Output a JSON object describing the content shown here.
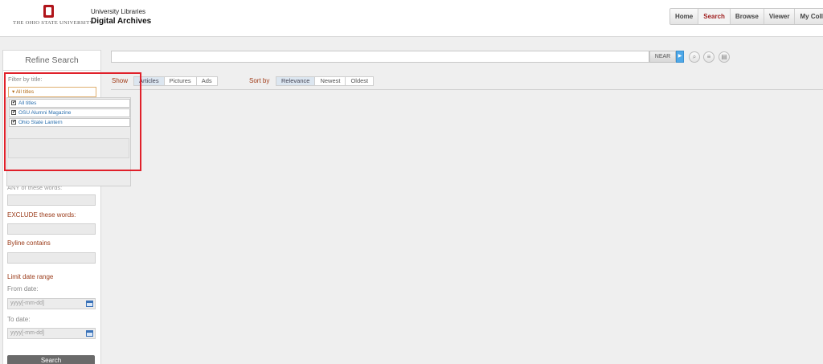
{
  "header": {
    "logo_text": "THE OHIO STATE UNIVERSITY",
    "brand_line1": "University Libraries",
    "brand_line2": "Digital Archives",
    "nav": [
      {
        "label": "Home"
      },
      {
        "label": "Search"
      },
      {
        "label": "Browse"
      },
      {
        "label": "Viewer"
      },
      {
        "label": "My Collecti"
      }
    ],
    "active_nav": "Search"
  },
  "sidebar": {
    "title": "Refine Search",
    "filter_label": "Filter by title:",
    "dropdown_value": "▾ All titles",
    "dropdown_items": [
      {
        "label": "All titles",
        "checked": true
      },
      {
        "label": "OSU Alumni Magazine",
        "checked": true
      },
      {
        "label": "Ohio State Lantern",
        "checked": true
      }
    ],
    "partial_label": "ANY of these words:",
    "exclude_label": "EXCLUDE these words:",
    "byline_label": "Byline contains",
    "date_range_label": "Limit date range",
    "from_label": "From date:",
    "to_label": "To date:",
    "date_placeholder": "yyyy[-mm-dd]",
    "search_button": "Search"
  },
  "main": {
    "near_label": "NEAR",
    "show_label": "Show",
    "show_options": [
      {
        "label": "Articles"
      },
      {
        "label": "Pictures"
      },
      {
        "label": "Ads"
      }
    ],
    "sort_label": "Sort by",
    "sort_options": [
      {
        "label": "Relevance"
      },
      {
        "label": "Newest"
      },
      {
        "label": "Oldest"
      }
    ]
  },
  "colors": {
    "brand_red": "#b0141a",
    "highlight": "#e0202a",
    "label_accent": "#a03a16",
    "link_blue": "#2a6fae"
  }
}
